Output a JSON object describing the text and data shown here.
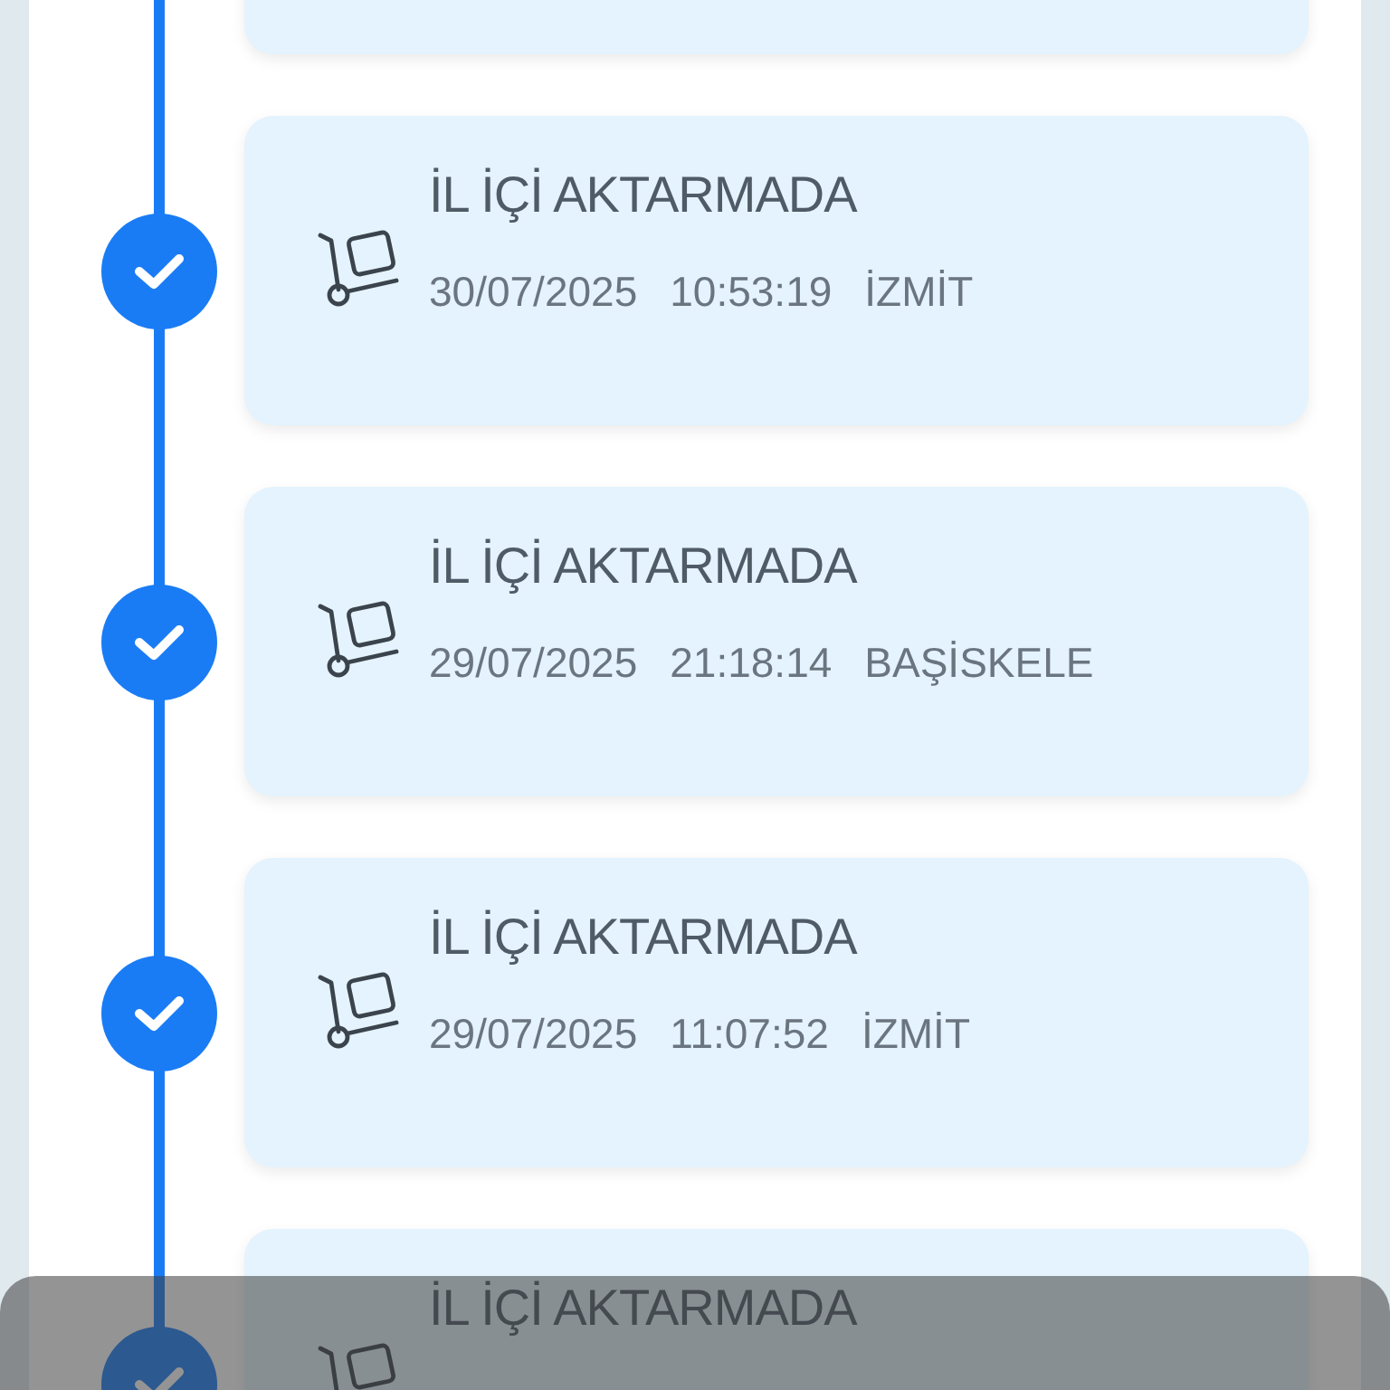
{
  "events": [
    {
      "title": "İL İÇİ AKTARMADA",
      "date": "30/07/2025",
      "time": "10:53:19",
      "location": "İZMİT",
      "done": true
    },
    {
      "title": "İL İÇİ AKTARMADA",
      "date": "29/07/2025",
      "time": "21:18:14",
      "location": "BAŞİSKELE",
      "done": true
    },
    {
      "title": "İL İÇİ AKTARMADA",
      "date": "29/07/2025",
      "time": "11:07:52",
      "location": "İZMİT",
      "done": true
    },
    {
      "title": "İL İÇİ AKTARMADA",
      "done": true
    }
  ]
}
